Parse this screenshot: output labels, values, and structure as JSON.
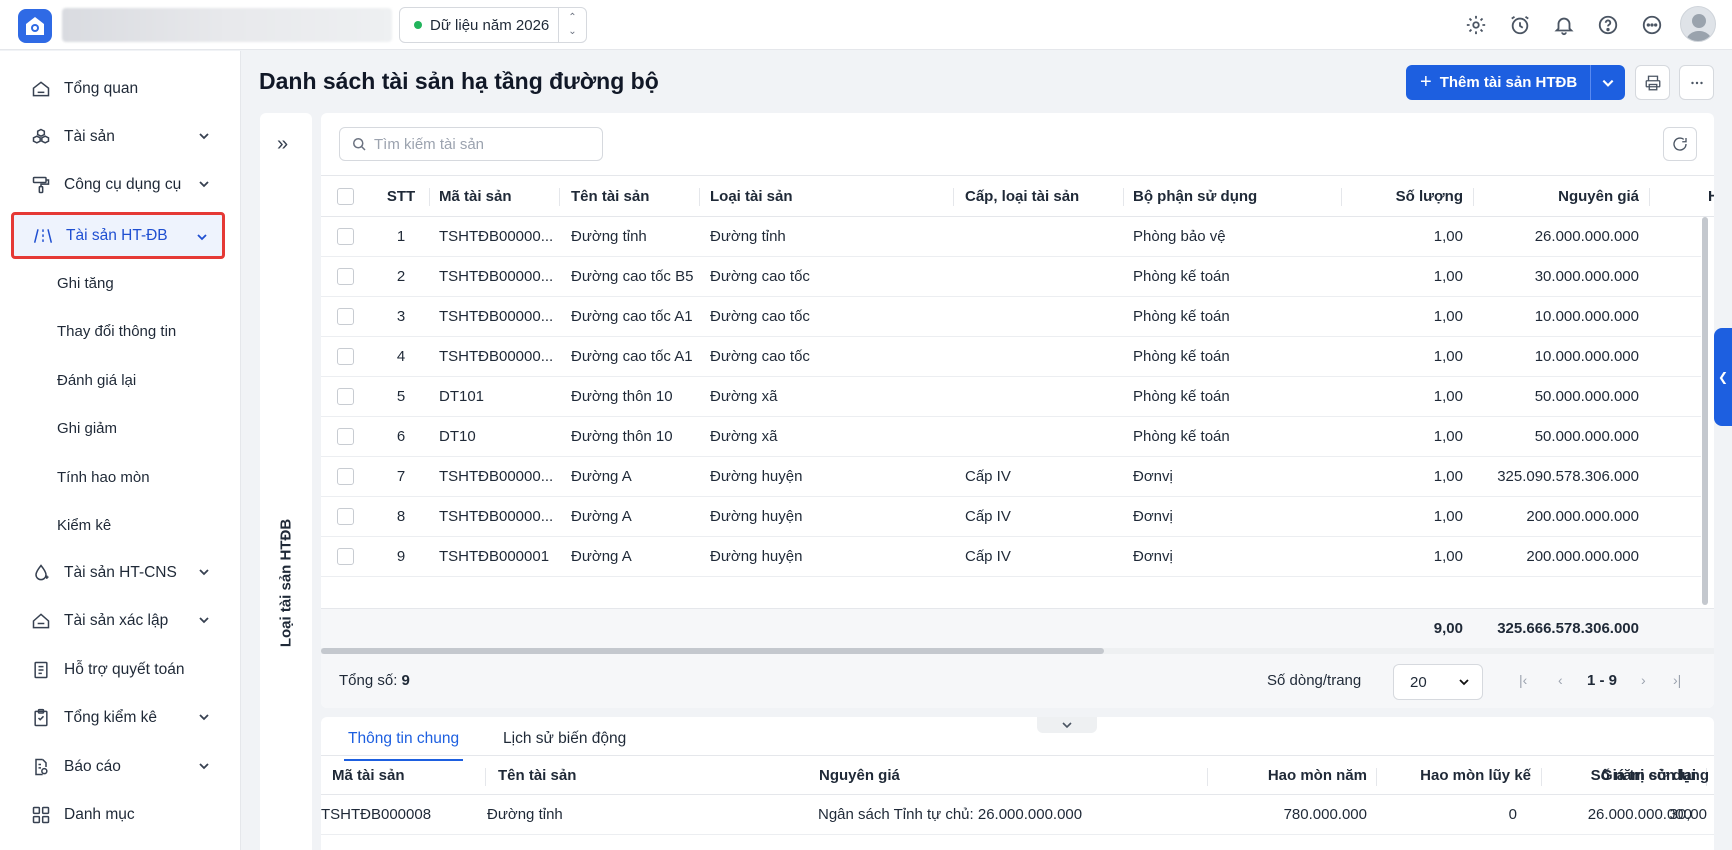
{
  "topbar": {
    "year_label": "Dữ liệu năm 2026",
    "icons": [
      "settings-icon",
      "alarm-clock-icon",
      "bell-icon",
      "help-icon",
      "more-icon"
    ]
  },
  "sidebar": {
    "items": [
      {
        "label": "Tổng quan",
        "icon": "home-icon"
      },
      {
        "label": "Tài sản",
        "icon": "boxes-icon",
        "expandable": true
      },
      {
        "label": "Công cụ dụng cụ",
        "icon": "paint-roller-icon",
        "expandable": true
      },
      {
        "label": "Tài sản HT-ĐB",
        "icon": "road-icon",
        "expandable": true,
        "active": true
      },
      {
        "label": "Tài sản HT-CNS",
        "icon": "water-drop-icon",
        "expandable": true
      },
      {
        "label": "Tài sản xác lập",
        "icon": "box-icon",
        "expandable": true
      },
      {
        "label": "Hỗ trợ quyết toán",
        "icon": "document-icon"
      },
      {
        "label": "Tổng kiểm kê",
        "icon": "clipboard-icon",
        "expandable": true
      },
      {
        "label": "Báo cáo",
        "icon": "report-icon",
        "expandable": true
      },
      {
        "label": "Danh mục",
        "icon": "grid-icon"
      }
    ],
    "sub_items": [
      "Ghi tăng",
      "Thay đổi thông tin",
      "Đánh giá lại",
      "Ghi giảm",
      "Tính hao mòn",
      "Kiểm kê"
    ]
  },
  "main": {
    "title": "Danh sách tài sản hạ tầng đường bộ",
    "add_button": "Thêm tài sản HTĐB",
    "category_panel_label": "Loại tài sản HTĐB",
    "search_placeholder": "Tìm kiếm tài sản"
  },
  "grid": {
    "columns": [
      "STT",
      "Mã tài sản",
      "Tên tài sản",
      "Loại tài sản",
      "Cấp, loại tài sản",
      "Bộ phận sử dụng",
      "Số lượng",
      "Nguyên giá",
      "H"
    ],
    "rows": [
      [
        "1",
        "TSHTĐB00000...",
        "Đường tỉnh",
        "Đường tỉnh",
        "",
        "Phòng bảo vệ",
        "1,00",
        "26.000.000.000"
      ],
      [
        "2",
        "TSHTĐB00000...",
        "Đường cao tốc B5",
        "Đường cao tốc",
        "",
        "Phòng kế toán",
        "1,00",
        "30.000.000.000"
      ],
      [
        "3",
        "TSHTĐB00000...",
        "Đường cao tốc A1",
        "Đường cao tốc",
        "",
        "Phòng kế toán",
        "1,00",
        "10.000.000.000"
      ],
      [
        "4",
        "TSHTĐB00000...",
        "Đường cao tốc A1",
        "Đường cao tốc",
        "",
        "Phòng kế toán",
        "1,00",
        "10.000.000.000"
      ],
      [
        "5",
        "DT101",
        "Đường thôn 10",
        "Đường xã",
        "",
        "Phòng kế toán",
        "1,00",
        "50.000.000.000"
      ],
      [
        "6",
        "DT10",
        "Đường thôn 10",
        "Đường xã",
        "",
        "Phòng kế toán",
        "1,00",
        "50.000.000.000"
      ],
      [
        "7",
        "TSHTĐB00000...",
        "Đường A",
        "Đường huyện",
        "Cấp IV",
        "Đơnvị",
        "1,00",
        "325.090.578.306.000"
      ],
      [
        "8",
        "TSHTĐB00000...",
        "Đường A",
        "Đường huyện",
        "Cấp IV",
        "Đơnvị",
        "1,00",
        "200.000.000.000"
      ],
      [
        "9",
        "TSHTĐB000001",
        "Đường A",
        "Đường huyện",
        "Cấp IV",
        "Đơnvị",
        "1,00",
        "200.000.000.000"
      ]
    ],
    "summary": {
      "quantity": "9,00",
      "cost": "325.666.578.306.000"
    },
    "footer": {
      "total_label": "Tổng số:",
      "total_value": "9",
      "page_size_label": "Số dòng/trang",
      "page_size": "20",
      "range": "1 - 9"
    }
  },
  "detail": {
    "tabs": [
      "Thông tin chung",
      "Lịch sử biến động"
    ],
    "columns": [
      "Mã tài sản",
      "Tên tài sản",
      "Nguyên giá",
      "Hao mòn năm",
      "Hao mòn lũy kế",
      "Giá trị còn lại",
      "Số năm sử dụng"
    ],
    "row": [
      "TSHTĐB000008",
      "Đường tỉnh",
      "Ngân sách Tỉnh tự chủ: 26.000.000.000",
      "780.000.000",
      "0",
      "26.000.000.000",
      "30,00"
    ]
  },
  "colors": {
    "accent": "#1d5fe0",
    "active_border": "#e53935",
    "status_dot": "#22b45c"
  }
}
